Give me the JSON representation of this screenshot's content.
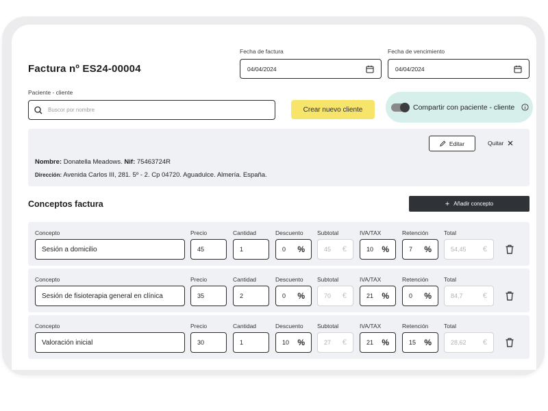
{
  "invoice": {
    "title": "Factura nº ES24-00004",
    "invoice_date_label": "Fecha de factura",
    "invoice_date_value": "04/04/2024",
    "due_date_label": "Fecha de vencimiento",
    "due_date_value": "04/04/2024"
  },
  "patient": {
    "label": "Paciente - cliente",
    "search_placeholder": "Buscor por nombre",
    "create_client_label": "Crear nuevo cliente",
    "share_label": "Compartir con paciente - cliente"
  },
  "client_card": {
    "edit_label": "Editar",
    "remove_label": "Quitar",
    "name_label": "Nombre:",
    "name_value": "Donatella Meadows.",
    "nif_label": "Nif:",
    "nif_value": "75463724R",
    "address_label": "Dirección:",
    "address_value": "Avenida Carlos III, 281. 5º - 2. Cp 04720. Aguadulce. Almería. España."
  },
  "concepts": {
    "section_title": "Conceptos factura",
    "add_label": "Añadir concepto",
    "labels": {
      "concept": "Concepto",
      "price": "Precio",
      "qty": "Cantidad",
      "discount": "Descuento",
      "subtotal": "Subtotal",
      "iva": "IVA/TAX",
      "retention": "Retención",
      "total": "Total"
    },
    "rows": [
      {
        "concept": "Sesión a domicilio",
        "price": "45",
        "qty": "1",
        "discount": "0",
        "subtotal": "45",
        "iva": "10",
        "retention": "7",
        "total": "54,45"
      },
      {
        "concept": "Sesión de fisioterapia general en clínica",
        "price": "35",
        "qty": "2",
        "discount": "0",
        "subtotal": "70",
        "iva": "21",
        "retention": "0",
        "total": "84,7"
      },
      {
        "concept": "Valoración inicial",
        "price": "30",
        "qty": "1",
        "discount": "10",
        "subtotal": "27",
        "iva": "21",
        "retention": "15",
        "total": "28,62"
      }
    ],
    "percent_symbol": "%",
    "currency_symbol": "€"
  },
  "colors": {
    "accent_yellow": "#f7e46a",
    "share_bg": "#d7efea",
    "dark_button": "#2f3237",
    "card_bg": "#f0f1f4"
  }
}
